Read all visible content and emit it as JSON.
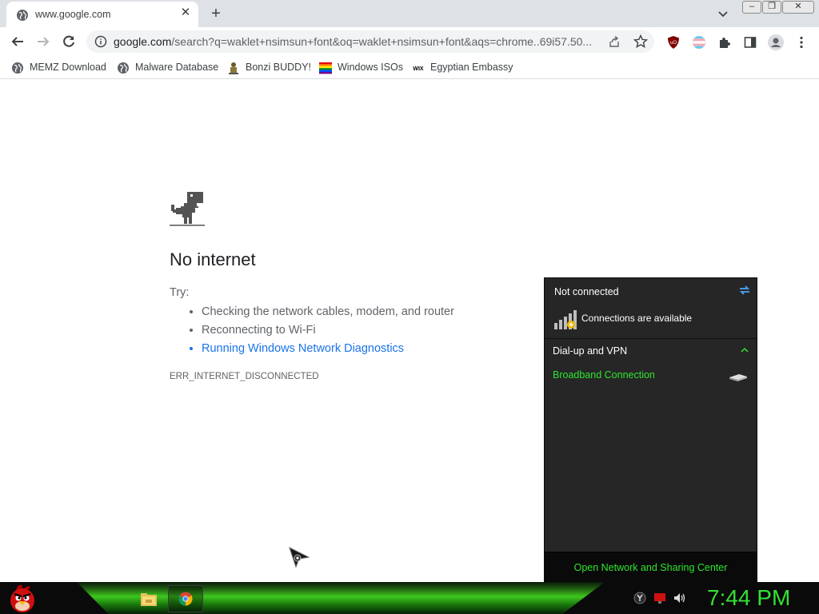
{
  "tab": {
    "title": "www.google.com",
    "close_glyph": "✕",
    "new_tab_glyph": "+"
  },
  "window_controls": {
    "minimize": "–",
    "restore": "❐",
    "close": "✕"
  },
  "toolbar": {
    "url_host": "google.com",
    "url_rest": "/search?q=waklet+nsimsun+font&oq=waklet+nsimsun+font&aqs=chrome..69i57.50..."
  },
  "bookmarks": [
    {
      "label": "MEMZ Download",
      "icon": "globe-icon"
    },
    {
      "label": "Malware Database",
      "icon": "globe-icon"
    },
    {
      "label": "Bonzi BUDDY!",
      "icon": "bonzi-icon"
    },
    {
      "label": "Windows ISOs",
      "icon": "rainbow-flag-icon"
    },
    {
      "label": "Egyptian Embassy",
      "icon": "wix-icon"
    }
  ],
  "bookmark_wix_text": "WIX",
  "page": {
    "heading": "No internet",
    "try_label": "Try:",
    "tips": [
      "Checking the network cables, modem, and router",
      "Reconnecting to Wi-Fi",
      "Running Windows Network Diagnostics"
    ],
    "error_code": "ERR_INTERNET_DISCONNECTED"
  },
  "network_flyout": {
    "status": "Not connected",
    "availability": "Connections are available",
    "section": "Dial-up and VPN",
    "connection": "Broadband Connection",
    "footer_link": "Open Network and Sharing Center",
    "accent_color": "#2ee62e"
  },
  "taskbar": {
    "clock": "7:44 PM",
    "clock_color": "#33e233"
  },
  "extensions": [
    "ublock-icon",
    "trans-flag-icon",
    "puzzle-icon",
    "sidepanel-icon",
    "profile-icon",
    "menu-icon"
  ]
}
